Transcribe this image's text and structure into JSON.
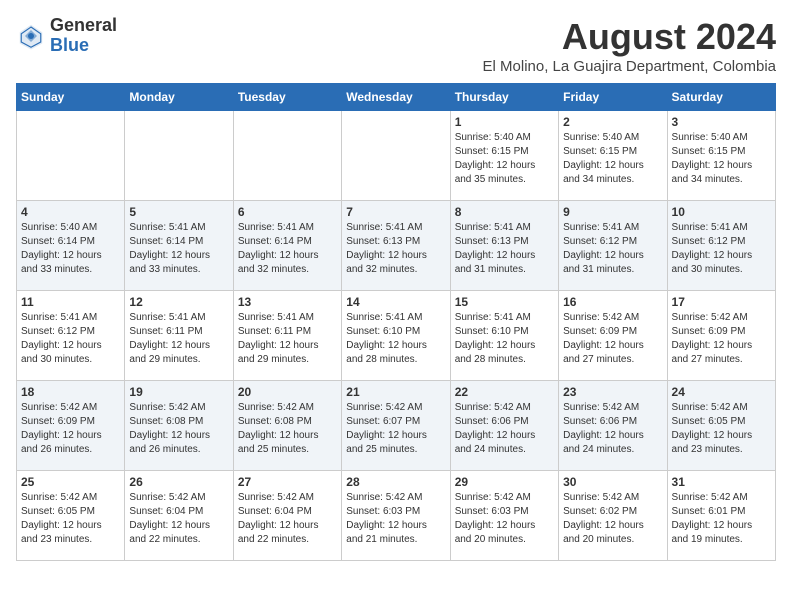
{
  "logo": {
    "general": "General",
    "blue": "Blue"
  },
  "header": {
    "month_year": "August 2024",
    "location": "El Molino, La Guajira Department, Colombia"
  },
  "days_of_week": [
    "Sunday",
    "Monday",
    "Tuesday",
    "Wednesday",
    "Thursday",
    "Friday",
    "Saturday"
  ],
  "weeks": [
    [
      {
        "day": "",
        "info": ""
      },
      {
        "day": "",
        "info": ""
      },
      {
        "day": "",
        "info": ""
      },
      {
        "day": "",
        "info": ""
      },
      {
        "day": "1",
        "info": "Sunrise: 5:40 AM\nSunset: 6:15 PM\nDaylight: 12 hours\nand 35 minutes."
      },
      {
        "day": "2",
        "info": "Sunrise: 5:40 AM\nSunset: 6:15 PM\nDaylight: 12 hours\nand 34 minutes."
      },
      {
        "day": "3",
        "info": "Sunrise: 5:40 AM\nSunset: 6:15 PM\nDaylight: 12 hours\nand 34 minutes."
      }
    ],
    [
      {
        "day": "4",
        "info": "Sunrise: 5:40 AM\nSunset: 6:14 PM\nDaylight: 12 hours\nand 33 minutes."
      },
      {
        "day": "5",
        "info": "Sunrise: 5:41 AM\nSunset: 6:14 PM\nDaylight: 12 hours\nand 33 minutes."
      },
      {
        "day": "6",
        "info": "Sunrise: 5:41 AM\nSunset: 6:14 PM\nDaylight: 12 hours\nand 32 minutes."
      },
      {
        "day": "7",
        "info": "Sunrise: 5:41 AM\nSunset: 6:13 PM\nDaylight: 12 hours\nand 32 minutes."
      },
      {
        "day": "8",
        "info": "Sunrise: 5:41 AM\nSunset: 6:13 PM\nDaylight: 12 hours\nand 31 minutes."
      },
      {
        "day": "9",
        "info": "Sunrise: 5:41 AM\nSunset: 6:12 PM\nDaylight: 12 hours\nand 31 minutes."
      },
      {
        "day": "10",
        "info": "Sunrise: 5:41 AM\nSunset: 6:12 PM\nDaylight: 12 hours\nand 30 minutes."
      }
    ],
    [
      {
        "day": "11",
        "info": "Sunrise: 5:41 AM\nSunset: 6:12 PM\nDaylight: 12 hours\nand 30 minutes."
      },
      {
        "day": "12",
        "info": "Sunrise: 5:41 AM\nSunset: 6:11 PM\nDaylight: 12 hours\nand 29 minutes."
      },
      {
        "day": "13",
        "info": "Sunrise: 5:41 AM\nSunset: 6:11 PM\nDaylight: 12 hours\nand 29 minutes."
      },
      {
        "day": "14",
        "info": "Sunrise: 5:41 AM\nSunset: 6:10 PM\nDaylight: 12 hours\nand 28 minutes."
      },
      {
        "day": "15",
        "info": "Sunrise: 5:41 AM\nSunset: 6:10 PM\nDaylight: 12 hours\nand 28 minutes."
      },
      {
        "day": "16",
        "info": "Sunrise: 5:42 AM\nSunset: 6:09 PM\nDaylight: 12 hours\nand 27 minutes."
      },
      {
        "day": "17",
        "info": "Sunrise: 5:42 AM\nSunset: 6:09 PM\nDaylight: 12 hours\nand 27 minutes."
      }
    ],
    [
      {
        "day": "18",
        "info": "Sunrise: 5:42 AM\nSunset: 6:09 PM\nDaylight: 12 hours\nand 26 minutes."
      },
      {
        "day": "19",
        "info": "Sunrise: 5:42 AM\nSunset: 6:08 PM\nDaylight: 12 hours\nand 26 minutes."
      },
      {
        "day": "20",
        "info": "Sunrise: 5:42 AM\nSunset: 6:08 PM\nDaylight: 12 hours\nand 25 minutes."
      },
      {
        "day": "21",
        "info": "Sunrise: 5:42 AM\nSunset: 6:07 PM\nDaylight: 12 hours\nand 25 minutes."
      },
      {
        "day": "22",
        "info": "Sunrise: 5:42 AM\nSunset: 6:06 PM\nDaylight: 12 hours\nand 24 minutes."
      },
      {
        "day": "23",
        "info": "Sunrise: 5:42 AM\nSunset: 6:06 PM\nDaylight: 12 hours\nand 24 minutes."
      },
      {
        "day": "24",
        "info": "Sunrise: 5:42 AM\nSunset: 6:05 PM\nDaylight: 12 hours\nand 23 minutes."
      }
    ],
    [
      {
        "day": "25",
        "info": "Sunrise: 5:42 AM\nSunset: 6:05 PM\nDaylight: 12 hours\nand 23 minutes."
      },
      {
        "day": "26",
        "info": "Sunrise: 5:42 AM\nSunset: 6:04 PM\nDaylight: 12 hours\nand 22 minutes."
      },
      {
        "day": "27",
        "info": "Sunrise: 5:42 AM\nSunset: 6:04 PM\nDaylight: 12 hours\nand 22 minutes."
      },
      {
        "day": "28",
        "info": "Sunrise: 5:42 AM\nSunset: 6:03 PM\nDaylight: 12 hours\nand 21 minutes."
      },
      {
        "day": "29",
        "info": "Sunrise: 5:42 AM\nSunset: 6:03 PM\nDaylight: 12 hours\nand 20 minutes."
      },
      {
        "day": "30",
        "info": "Sunrise: 5:42 AM\nSunset: 6:02 PM\nDaylight: 12 hours\nand 20 minutes."
      },
      {
        "day": "31",
        "info": "Sunrise: 5:42 AM\nSunset: 6:01 PM\nDaylight: 12 hours\nand 19 minutes."
      }
    ]
  ]
}
